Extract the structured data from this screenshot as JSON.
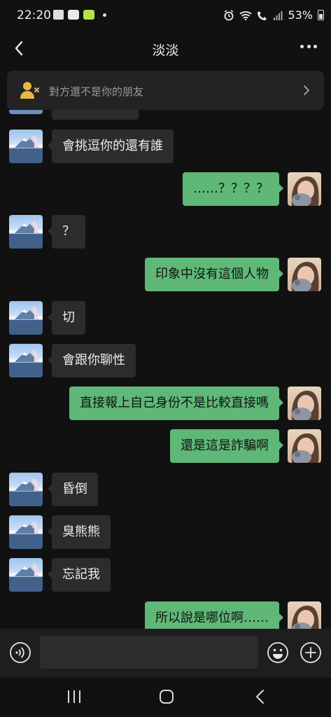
{
  "status_bar": {
    "time": "22:20",
    "battery_percent": "53%",
    "left_icons": [
      "gallery-icon",
      "webtoon-icon",
      "line-icon",
      "notification-dot"
    ],
    "right_icons": [
      "alarm-icon",
      "wifi-icon",
      "wifi-call-icon",
      "signal-icon",
      "battery-icon"
    ]
  },
  "header": {
    "title": "淡淡"
  },
  "notice": {
    "text": "對方還不是你的朋友"
  },
  "messages": [
    {
      "side": "left",
      "text": "會挑逗你的還有誰"
    },
    {
      "side": "right",
      "text": "……？？？？"
    },
    {
      "side": "left",
      "text": "？"
    },
    {
      "side": "right",
      "text": "印象中沒有這個人物"
    },
    {
      "side": "left",
      "text": "切"
    },
    {
      "side": "left",
      "text": "會跟你聊性"
    },
    {
      "side": "right",
      "text": "直接報上自己身份不是比較直接嗎"
    },
    {
      "side": "right",
      "text": "還是這是詐騙啊"
    },
    {
      "side": "left",
      "text": "昏倒"
    },
    {
      "side": "left",
      "text": "臭熊熊"
    },
    {
      "side": "left",
      "text": "忘記我"
    },
    {
      "side": "right",
      "text": "所以說是哪位啊……"
    }
  ],
  "input": {
    "value": "",
    "placeholder": ""
  },
  "colors": {
    "background": "#111111",
    "incoming_bubble": "#2c2c2c",
    "outgoing_bubble": "#5fb877",
    "notice_bg": "#232323",
    "input_bar_bg": "#1e1e1e",
    "friend_icon": "#e8b847"
  }
}
